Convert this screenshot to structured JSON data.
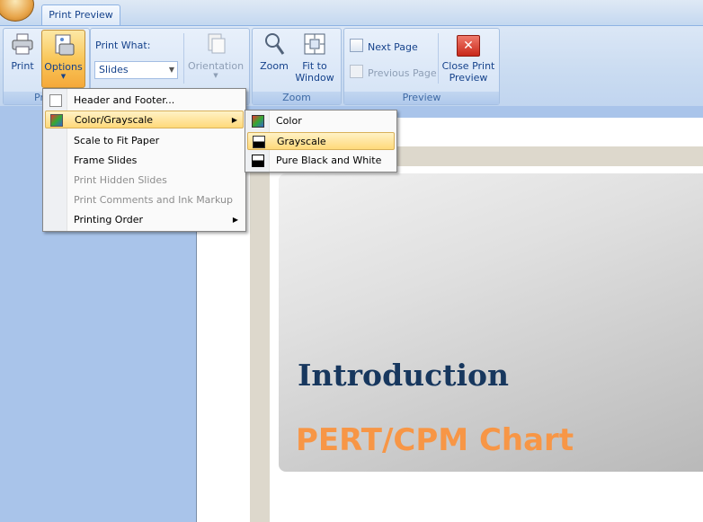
{
  "tabs": [
    {
      "label": "Print Preview"
    }
  ],
  "ribbon": {
    "print": {
      "label": "Print",
      "group_label_partial": "Pr"
    },
    "options": {
      "label": "Options"
    },
    "print_what": {
      "label": "Print What:",
      "value": "Slides"
    },
    "orientation": {
      "label": "Orientation"
    },
    "zoom": {
      "label": "Zoom"
    },
    "fit_to_window": {
      "line1": "Fit to",
      "line2": "Window"
    },
    "zoom_group_label": "Zoom",
    "next_page": {
      "label": "Next Page"
    },
    "previous_page": {
      "label": "Previous Page"
    },
    "close_print_preview": {
      "line1": "Close Print",
      "line2": "Preview"
    },
    "preview_group_label": "Preview"
  },
  "options_menu": {
    "items": [
      {
        "label": "Header and Footer...",
        "icon": "header-footer-icon",
        "enabled": true
      },
      {
        "label": "Color/Grayscale",
        "icon": "color-grayscale-icon",
        "enabled": true,
        "submenu": true
      },
      {
        "label": "Scale to Fit Paper",
        "enabled": true
      },
      {
        "label": "Frame Slides",
        "enabled": true
      },
      {
        "label": "Print Hidden Slides",
        "enabled": false
      },
      {
        "label": "Print Comments and Ink Markup",
        "enabled": false
      },
      {
        "label": "Printing Order",
        "enabled": true,
        "submenu": true
      }
    ]
  },
  "color_submenu": {
    "items": [
      {
        "label": "Color",
        "icon": "color-swatch-icon"
      },
      {
        "label": "Grayscale",
        "icon": "grayscale-swatch-icon",
        "selected": true
      },
      {
        "label": "Pure Black and White",
        "icon": "black-white-swatch-icon"
      }
    ]
  },
  "slide": {
    "title": "Introduction",
    "subtitle": "PERT/CPM Chart"
  },
  "colors": {
    "slide_title": "#17375e",
    "slide_subtitle": "#f79646",
    "workspace_bg": "#a9c4ea",
    "ribbon_text": "#15428b"
  }
}
